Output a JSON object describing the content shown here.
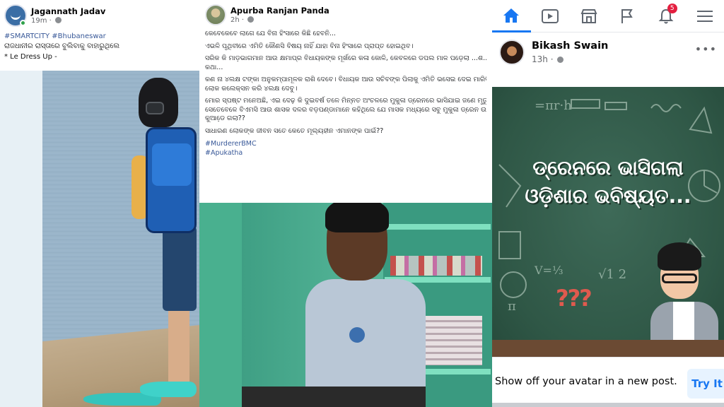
{
  "post_left": {
    "author": "Jagannath Jadav",
    "time": "19m",
    "hashtags": "#SMARTCITY #Bhubaneswar",
    "text_line1": "ରାଜଧାନୀର ରାସ୍ତାରେ ବୁଲିବାକୁ ବାହାରୁଥିଲେ",
    "text_line2": "* Le Dress Up -"
  },
  "post_middle": {
    "author": "Apurba Ranjan Panda",
    "time": "2h",
    "paragraphs": [
      "କେବେକେବେ ଲାଗେ ଯେ ବିନା ହିଂସାରେ କିଛି ହେବନି...",
      "ଏଭଳି ପୃଥିବୀରେ ଏମିତି କୌଣସି ବିଷୟ ନାହିଁ ଯାହା ବିନା ହିଂସାରେ ପ୍ରାପ୍ତ ହୋଇଥିବ।",
      "ସରିକ କି ମାଡ଼ଭାଗମାନ ଆଉ କ୍ଷମାପ୍ର ବିଧାୟକଙ୍କ ମୂର୍ଖରେ କଳା କୋଳି, କେବଳରେ ଡପଲ ମାଳ ପଡ଼େଲା ...ଶ...ଲୁ ଭାଗବାର",
      "କଥା...",
      "କଣ ନା ୪ଲକ୍ଷ ଟଙ୍କା ଅନୁକମ୍ପାମୂଳକ ରାଶି ଦେବେ। ବିଧାୟକ ଆଉ ସଚିବଙ୍କ ପିଲାକୁ ଏମିତି ଭସେଇ ଦେଇ ମାରିଦିଅନ୍ତୁ। ଅ",
      "ଲୋକ କଲେକ୍ସନ କରି ୪ଲକ୍ଷ ଦେବୁ।",
      "ମୋର ସ୍ପଷ୍ଟ ମନେଅଛି, ଏଇ ଦେଢ଼ କି ଦୁଇବର୍ଷ ତଳେ ମିନ୍ନତ ଅଂଚଳରେ ମୁକୁଳା ଡ୍ରେନରେ ଭାସିଯାଇ ଜଣେ ମୃତ୍ୟୁବରଣ",
      "ସେତେବେଳେ ବିଏମସି ଆଉ ଶାସକ ଦଳର ବଡ଼ପଣ୍ଡାମାନେ କହିଥିଲେ ଯେ ମାସକ ମଧ୍ୟରେ ସବୁ ମୁକୁଳା ଡ୍ରେନ ଉପରେ",
      "କୁଆଡେ଼ ଗଲା??",
      "ସାଧାରଣ ଲୋକଙ୍କ ଜୀବନ ସତେ କେତେ ମୂଲ୍ୟହୀନ ଏମାନଙ୍କ ପାଇଁ??"
    ],
    "hashtag1": "#MurdererBMC",
    "hashtag2": "#Apukatha"
  },
  "nav": {
    "items": [
      {
        "name": "home",
        "icon": "home-icon",
        "active": true
      },
      {
        "name": "watch",
        "icon": "video-icon"
      },
      {
        "name": "marketplace",
        "icon": "store-icon"
      },
      {
        "name": "pages",
        "icon": "flag-icon"
      },
      {
        "name": "notifications",
        "icon": "bell-icon",
        "badge": "5"
      },
      {
        "name": "menu",
        "icon": "hamburger-icon"
      }
    ],
    "accent": "#1877f2",
    "badge_color": "#e41e3f"
  },
  "post_right": {
    "author": "Bikash Swain",
    "time": "13h",
    "more": "•••",
    "board_line1": "ଡ୍ରେନରେ ଭାସିଗଲା",
    "board_line2": "ଓଡ଼ିଶାର ଭବିଷ୍ୟତ...",
    "question_marks": "???"
  },
  "ad": {
    "text": "Show off your avatar in a new post.",
    "button": "Try It"
  }
}
